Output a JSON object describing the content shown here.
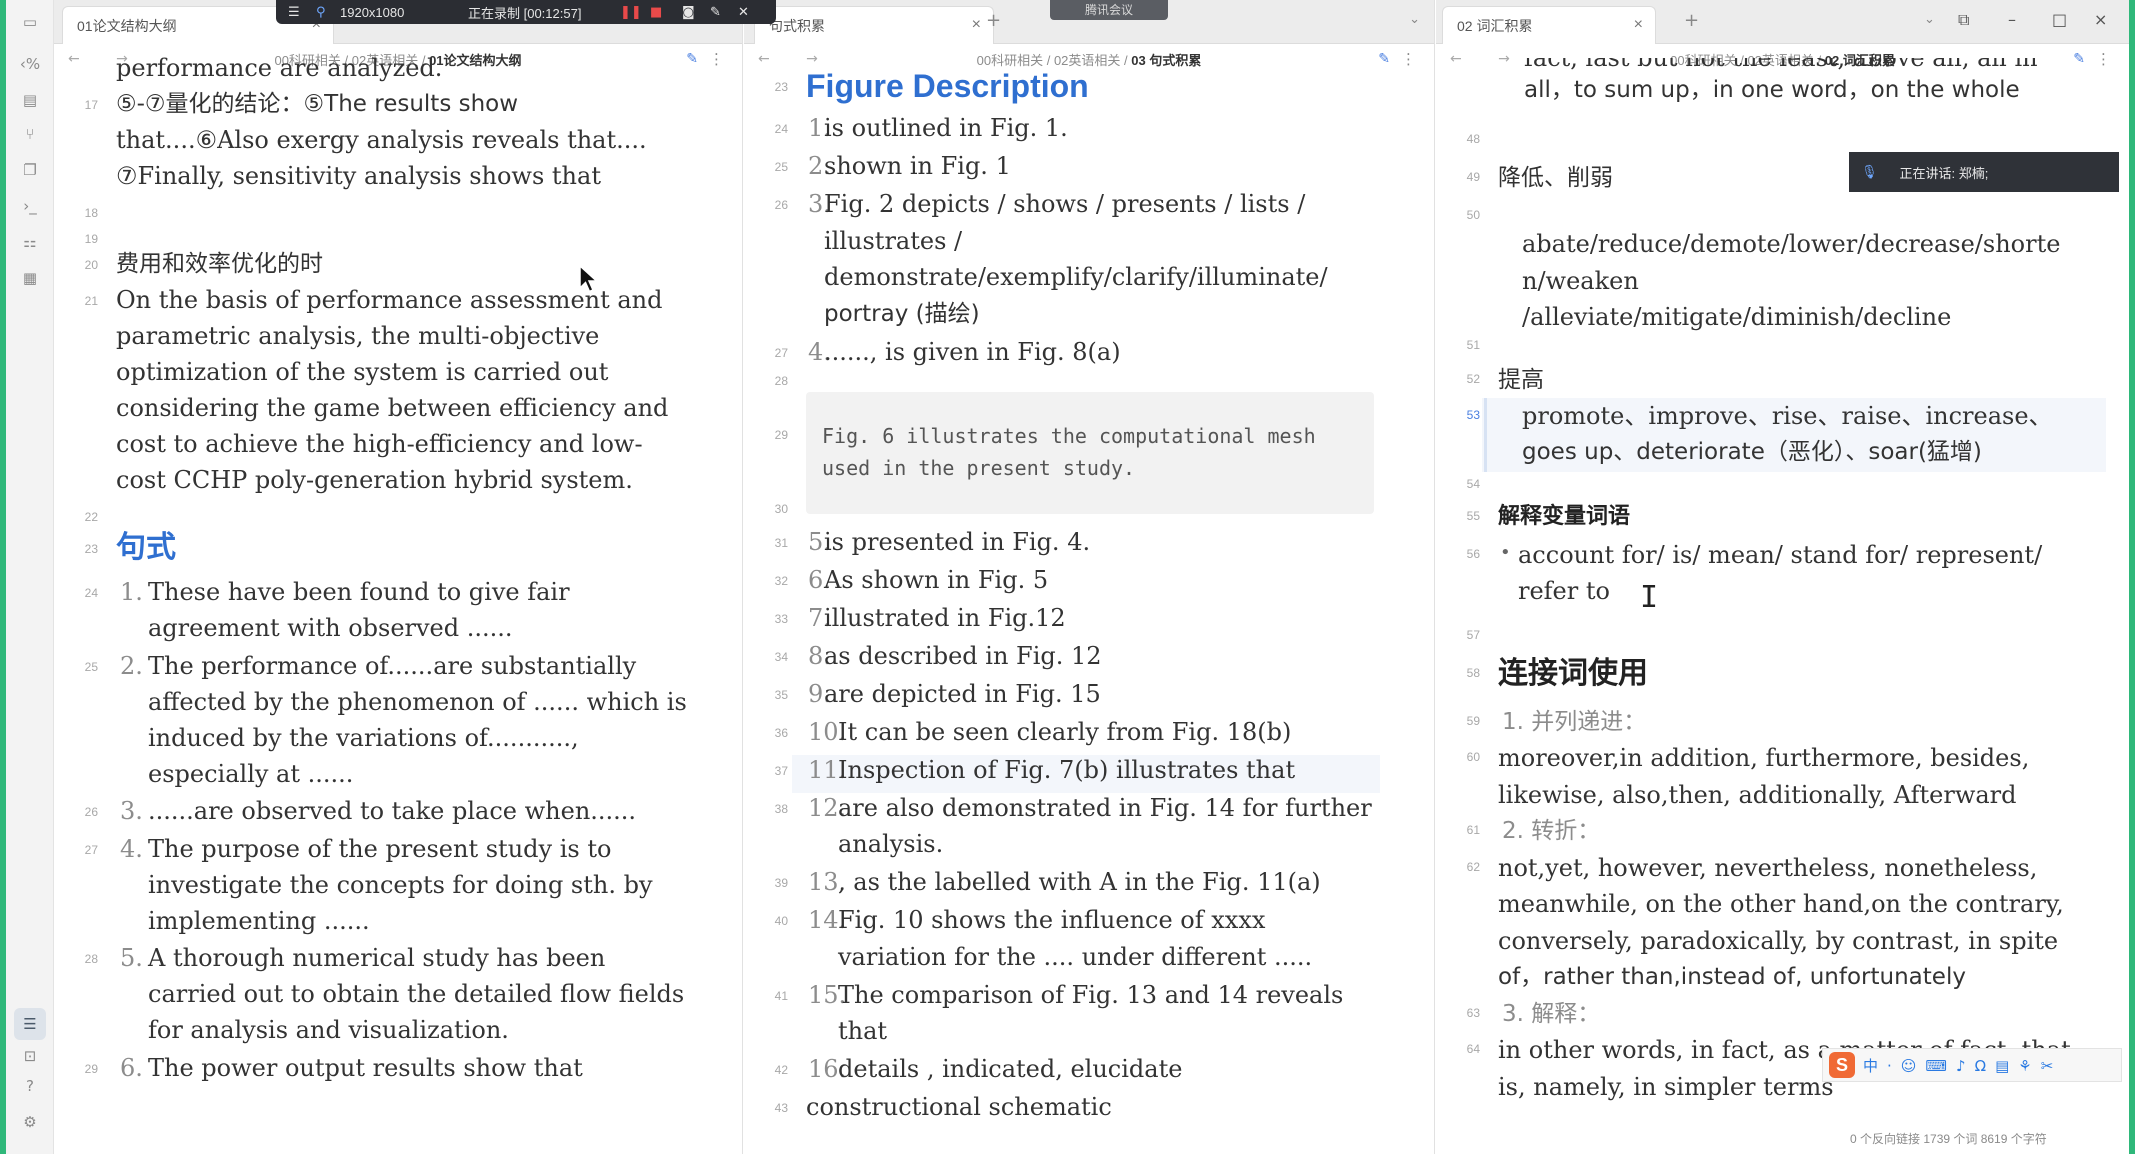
{
  "recording": {
    "resolution": "1920x1080",
    "status": "正在录制 [00:12:57]"
  },
  "meeting_badge": "腾讯会议",
  "speaking": "正在讲话: 郑楠;",
  "pane_a": {
    "tab_title": "01论文结构大纲",
    "crumb_prefix": "00科研相关 / 02英语相关 / ",
    "crumb_current": "01论文结构大纲",
    "lines": [
      {
        "ln": "",
        "text": "performance are analyzed."
      },
      {
        "ln": "17",
        "text": "⑤-⑦量化的结论：⑤The results show"
      },
      {
        "ln": "",
        "text": "that....⑥Also exergy analysis reveals that...."
      },
      {
        "ln": "",
        "text": "⑦Finally, sensitivity analysis shows that"
      },
      {
        "ln": "18",
        "text": ""
      },
      {
        "ln": "19",
        "text": ""
      },
      {
        "ln": "20",
        "text": "费用和效率优化的时"
      },
      {
        "ln": "21",
        "text": "On the basis of performance assessment and"
      },
      {
        "ln": "",
        "text": "parametric analysis, the multi-objective"
      },
      {
        "ln": "",
        "text": "optimization of the system is carried out"
      },
      {
        "ln": "",
        "text": "considering the game between efficiency and"
      },
      {
        "ln": "",
        "text": "cost to achieve the high-efficiency and low-"
      },
      {
        "ln": "",
        "text": "cost CCHP poly-generation hybrid system."
      },
      {
        "ln": "22",
        "text": ""
      }
    ],
    "heading_ln": "23",
    "heading": "句式",
    "list": [
      {
        "ln": "24",
        "num": "1.",
        "lines": [
          "These have been found to give fair",
          "agreement with observed ......"
        ]
      },
      {
        "ln": "25",
        "num": "2.",
        "lines": [
          "The performance of......are substantially",
          "affected by the phenomenon of ...... which is",
          "induced by the variations of...........,",
          "especially at ......"
        ]
      },
      {
        "ln": "26",
        "num": "3.",
        "lines": [
          "......are observed to take place when......"
        ]
      },
      {
        "ln": "27",
        "num": "4.",
        "lines": [
          "The purpose of the present study is to",
          "investigate the concepts for doing sth. by",
          "implementing ......"
        ]
      },
      {
        "ln": "28",
        "num": "5.",
        "lines": [
          "A thorough numerical study has been",
          "carried out to obtain the detailed flow fields",
          "for analysis and visualization."
        ]
      },
      {
        "ln": "29",
        "num": "6.",
        "lines": [
          "The power output results show that"
        ]
      }
    ]
  },
  "pane_b": {
    "tab_title": "句式积累",
    "crumb_prefix": "00科研相关 / 02英语相关 / ",
    "crumb_current": "03 句式积累",
    "heading_ln": "23",
    "heading": "Figure Description",
    "items": [
      {
        "ln": "24",
        "num": "1.",
        "lines": [
          "is outlined in Fig. 1."
        ]
      },
      {
        "ln": "25",
        "num": "2.",
        "lines": [
          "shown in Fig. 1"
        ]
      },
      {
        "ln": "26",
        "num": "3.",
        "lines": [
          " Fig. 2 depicts / shows / presents / lists /",
          "illustrates /",
          "demonstrate/exemplify/clarify/illuminate/",
          "portray (描绘)"
        ]
      },
      {
        "ln": "27",
        "num": "4.",
        "lines": [
          "......, is given in Fig. 8(a)"
        ]
      }
    ],
    "code_lns": [
      "28",
      "29",
      "30"
    ],
    "code_lines": [
      "Fig. 6 illustrates the computational mesh",
      "used in the present study."
    ],
    "items2": [
      {
        "ln": "31",
        "num": "5.",
        "lines": [
          "is presented in Fig. 4."
        ]
      },
      {
        "ln": "32",
        "num": "6.",
        "lines": [
          "As shown in Fig. 5"
        ]
      },
      {
        "ln": "33",
        "num": "7.",
        "lines": [
          "illustrated in Fig.12"
        ]
      },
      {
        "ln": "34",
        "num": "8.",
        "lines": [
          "as described in Fig. 12"
        ]
      },
      {
        "ln": "35",
        "num": "9.",
        "lines": [
          "are depicted in Fig. 15"
        ]
      },
      {
        "ln": "36",
        "num": "10.",
        "lines": [
          "It can be seen clearly from Fig. 18(b)"
        ]
      },
      {
        "ln": "37",
        "num": "11.",
        "lines": [
          "Inspection of Fig. 7(b) illustrates that"
        ]
      },
      {
        "ln": "38",
        "num": "12.",
        "lines": [
          "are also demonstrated in Fig. 14 for further",
          "analysis."
        ]
      },
      {
        "ln": "39",
        "num": "13.",
        "lines": [
          " , as the labelled with A in the Fig. 11(a)"
        ]
      },
      {
        "ln": "40",
        "num": "14.",
        "lines": [
          "Fig. 10 shows the influence of xxxx",
          "variation for the .... under different ....."
        ]
      },
      {
        "ln": "41",
        "num": "15.",
        "lines": [
          "The comparison of Fig. 13 and 14 reveals",
          "that"
        ]
      },
      {
        "ln": "42",
        "num": "16.",
        "lines": [
          "details ,  indicated, elucidate"
        ]
      }
    ],
    "last_ln": "43",
    "last_text": "constructional schematic"
  },
  "pane_c": {
    "tab_title": "02 词汇积累",
    "crumb_prefix": "00科研相关 / 02英语相关 / ",
    "crumb_current": "02 词汇积累",
    "top_partial": "fact, last but not the least, above all, all in",
    "top_line": "all，to sum up，in one word，on the whole",
    "blocks": [
      {
        "ln": "48",
        "text": ""
      },
      {
        "ln": "49",
        "text": "降低、削弱"
      },
      {
        "ln": "50",
        "text": ""
      }
    ],
    "reduce_lines": [
      "abate/reduce/demote/lower/decrease/shorte",
      "n/weaken",
      "/alleviate/mitigate/diminish/decline"
    ],
    "ln51": "51",
    "ln52": "52",
    "raise_heading": "提高",
    "ln53": "53",
    "raise_lines": [
      "promote、improve、rise、raise、increase、",
      "goes up、deteriorate（恶化）、soar(猛增)"
    ],
    "ln54": "54",
    "ln55": "55",
    "explain_heading": "解释变量词语",
    "ln56": "56",
    "explain_lines": [
      "account for/ is/ mean/ stand for/ represent/",
      "refer to"
    ],
    "ln57": "57",
    "ln58": "58",
    "connect_heading": "连接词使用",
    "ln59": "59",
    "sub1": "1. 并列递进：",
    "ln60": "60",
    "sub1_lines": [
      "moreover,in addition, furthermore, besides,",
      "likewise, also,then, additionally, Afterward"
    ],
    "ln61": "61",
    "sub2": "2. 转折：",
    "ln62": "62",
    "sub2_lines": [
      "not,yet, however, nevertheless, nonetheless,",
      "meanwhile, on the other hand,on the contrary,",
      "conversely, paradoxically, by contrast, in spite",
      "of，rather than,instead of, unfortunately"
    ],
    "ln63": "63",
    "sub3": "3. 解释：",
    "ln64": "64",
    "sub3_lines": [
      "in other words, in fact, as a matter of fact, that",
      "is, namely, in simpler terms"
    ]
  },
  "status_bar": "0 个反向链接   1739 个词   8619 个字符",
  "colors": {
    "accent_green": "#2fb87a",
    "heading_blue": "#2f6fd0",
    "link_blue": "#4a7fe0"
  }
}
